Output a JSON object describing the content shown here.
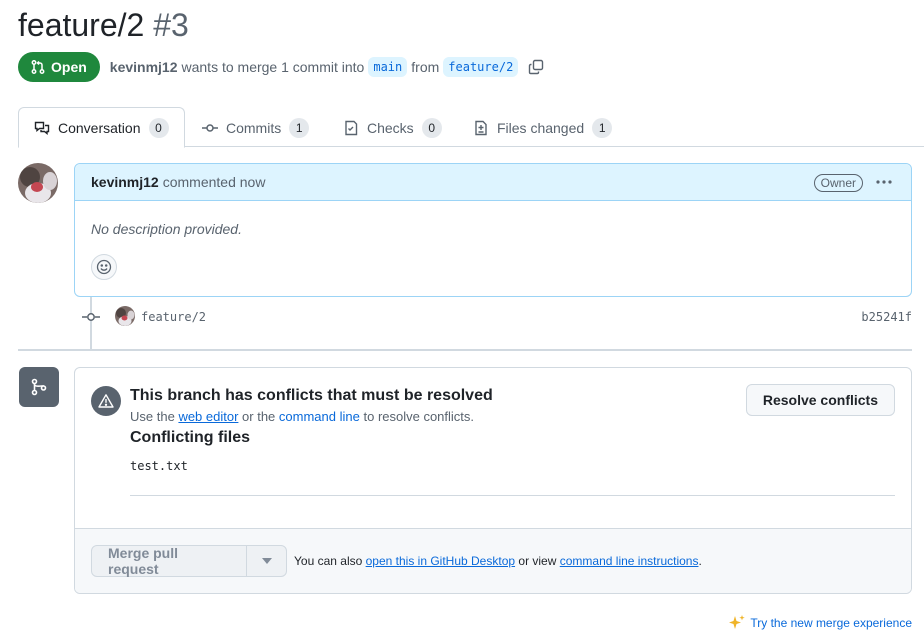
{
  "pr": {
    "title": "feature/2",
    "number": "#3",
    "state": "Open",
    "author": "kevinmj12",
    "summary_pre": "wants to merge 1 commit into",
    "base_branch": "main",
    "from_word": "from",
    "head_branch": "feature/2"
  },
  "tabs": [
    {
      "label": "Conversation",
      "count": "0",
      "icon": "comment-discussion-icon"
    },
    {
      "label": "Commits",
      "count": "1",
      "icon": "git-commit-icon"
    },
    {
      "label": "Checks",
      "count": "0",
      "icon": "checklist-icon"
    },
    {
      "label": "Files changed",
      "count": "1",
      "icon": "file-diff-icon"
    }
  ],
  "comment": {
    "author": "kevinmj12",
    "when": "commented now",
    "role": "Owner",
    "body": "No description provided."
  },
  "commit": {
    "message": "feature/2",
    "sha": "b25241f"
  },
  "merge": {
    "conflict_title": "This branch has conflicts that must be resolved",
    "sub_pre": "Use the",
    "web_editor": "web editor",
    "sub_mid": "or the",
    "command_line": "command line",
    "sub_post": "to resolve conflicts.",
    "resolve_button": "Resolve conflicts",
    "files_title": "Conflicting files",
    "files": [
      "test.txt"
    ],
    "merge_button": "Merge pull request",
    "foot_pre": "You can also",
    "open_desktop": "open this in GitHub Desktop",
    "foot_mid": "or view",
    "cli_instructions": "command line instructions",
    "foot_post": "."
  },
  "try_new": "Try the new merge experience",
  "colors": {
    "open_green": "#1f883d",
    "link_blue": "#0969da",
    "comment_header_bg": "#ddf4ff",
    "border": "#d1d9e0"
  }
}
